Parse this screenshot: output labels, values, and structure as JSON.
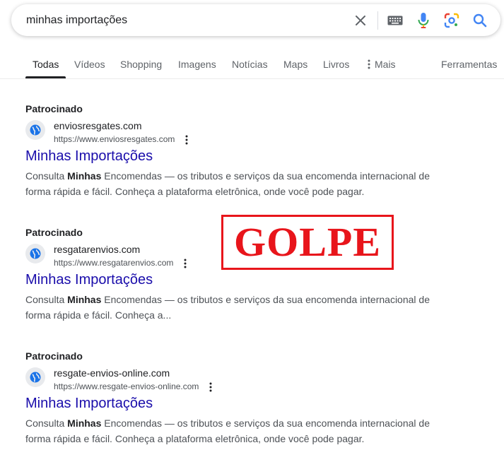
{
  "search": {
    "query": "minhas importações",
    "clear_icon": "close-icon",
    "keyboard_icon": "keyboard-icon",
    "voice_icon": "microphone-icon",
    "lens_icon": "google-lens-icon",
    "search_icon": "search-icon"
  },
  "tabs": [
    {
      "label": "Todas",
      "active": true
    },
    {
      "label": "Vídeos"
    },
    {
      "label": "Shopping"
    },
    {
      "label": "Imagens"
    },
    {
      "label": "Notícias"
    },
    {
      "label": "Maps"
    },
    {
      "label": "Livros"
    },
    {
      "label": "Mais",
      "icon": "more-vert-icon"
    },
    {
      "label": "Ferramentas"
    }
  ],
  "ads": [
    {
      "sponsored_label": "Patrocinado",
      "site_name": "enviosresgates.com",
      "url": "https://www.enviosresgates.com",
      "title": "Minhas Importações",
      "desc_pre": "Consulta ",
      "desc_bold": "Minhas",
      "desc_post": " Encomendas — os tributos e serviços da sua encomenda internacional de forma rápida e fácil. Conheça a plataforma eletrônica, onde você pode pagar."
    },
    {
      "sponsored_label": "Patrocinado",
      "site_name": "resgatarenvios.com",
      "url": "https://www.resgatarenvios.com",
      "title": "Minhas Importações",
      "desc_pre": "Consulta ",
      "desc_bold": "Minhas",
      "desc_post": " Encomendas — os tributos e serviços da sua encomenda internacional de forma rápida e fácil. Conheça a..."
    },
    {
      "sponsored_label": "Patrocinado",
      "site_name": "resgate-envios-online.com",
      "url": "https://www.resgate-envios-online.com",
      "title": "Minhas Importações",
      "desc_pre": "Consulta ",
      "desc_bold": "Minhas",
      "desc_post": " Encomendas — os tributos e serviços da sua encomenda internacional de forma rápida e fácil. Conheça a plataforma eletrônica, onde você pode pagar."
    }
  ],
  "stamp": {
    "text": "GOLPE",
    "color": "#e8151b"
  },
  "colors": {
    "link": "#1a0dab",
    "text": "#202124",
    "muted": "#4d5156"
  }
}
